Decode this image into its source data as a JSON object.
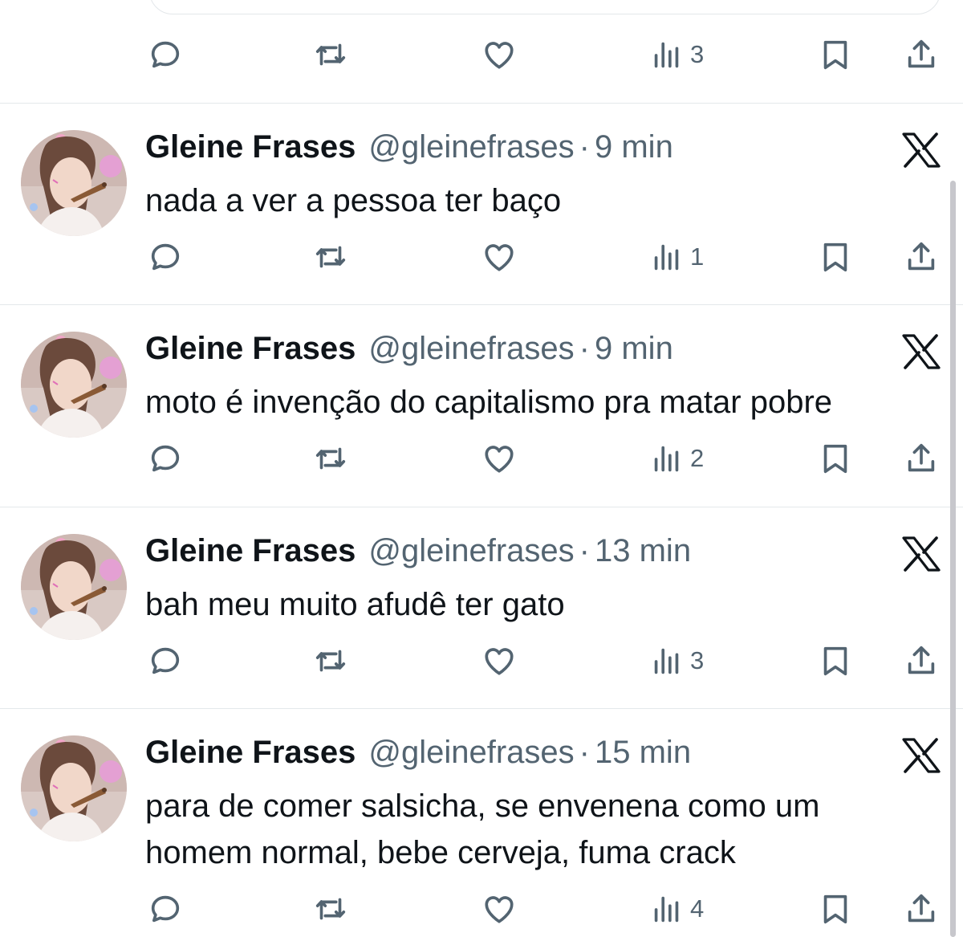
{
  "top_bar": {
    "views": "3"
  },
  "tweets": [
    {
      "name": "Gleine Frases",
      "handle": "@gleinefrases",
      "separator": "·",
      "time": "9 min",
      "lines": [
        "nada a ver a pessoa ter baço"
      ],
      "views": "1"
    },
    {
      "name": "Gleine Frases",
      "handle": "@gleinefrases",
      "separator": "·",
      "time": "9 min",
      "lines": [
        "moto é invenção do capitalismo pra matar pobre"
      ],
      "views": "2"
    },
    {
      "name": "Gleine Frases",
      "handle": "@gleinefrases",
      "separator": "·",
      "time": "13 min",
      "lines": [
        "bah meu muito afudê ter gato"
      ],
      "views": "3"
    },
    {
      "name": "Gleine Frases",
      "handle": "@gleinefrases",
      "separator": "·",
      "time": "15 min",
      "lines": [
        "para de comer salsicha, se envenena como um",
        "homem normal, bebe cerveja, fuma crack"
      ],
      "views": "4"
    }
  ],
  "icons": {
    "reply": "reply-icon",
    "retweet": "retweet-icon",
    "like": "heart-icon",
    "views": "views-icon",
    "bookmark": "bookmark-icon",
    "share": "share-icon",
    "x_logo": "x-logo-icon"
  },
  "colors": {
    "text": "#0f1419",
    "secondary": "#536471",
    "divider": "#e4e8eb"
  }
}
